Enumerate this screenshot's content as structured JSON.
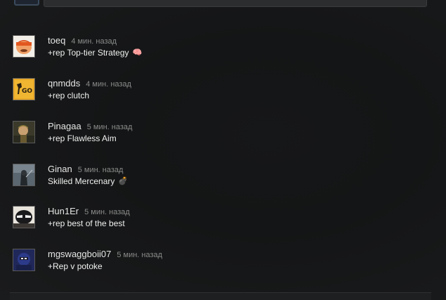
{
  "comments": [
    {
      "author": "toeq",
      "time": "4 мин. назад",
      "text": "+rep Top-tier Strategy",
      "emoji": "🧠",
      "avatar_icon": "cartman-icon",
      "avatar_color": "#d06a20"
    },
    {
      "author": "qnmdds",
      "time": "4 мин. назад",
      "text": "+rep clutch",
      "emoji": "",
      "avatar_icon": "csgo-logo-icon",
      "avatar_color": "#e3a02a"
    },
    {
      "author": "Pinagaa",
      "time": "5 мин. назад",
      "text": "+rep Flawless Aim",
      "emoji": "",
      "avatar_icon": "soldier-icon",
      "avatar_color": "#7a6a3a"
    },
    {
      "author": "Ginan",
      "time": "5 мин. назад",
      "text": "Skilled Mercenary",
      "emoji": "💣",
      "avatar_icon": "knight-icon",
      "avatar_color": "#4a5560"
    },
    {
      "author": "Hun1Er",
      "time": "5 мин. назад",
      "text": "+rep best of the best",
      "emoji": "",
      "avatar_icon": "masked-hero-icon",
      "avatar_color": "#3b3a36"
    },
    {
      "author": "mgswaggboii07",
      "time": "5 мин. назад",
      "text": "+Rep v potoke",
      "emoji": "",
      "avatar_icon": "ninja-icon",
      "avatar_color": "#2d3a7a"
    }
  ]
}
